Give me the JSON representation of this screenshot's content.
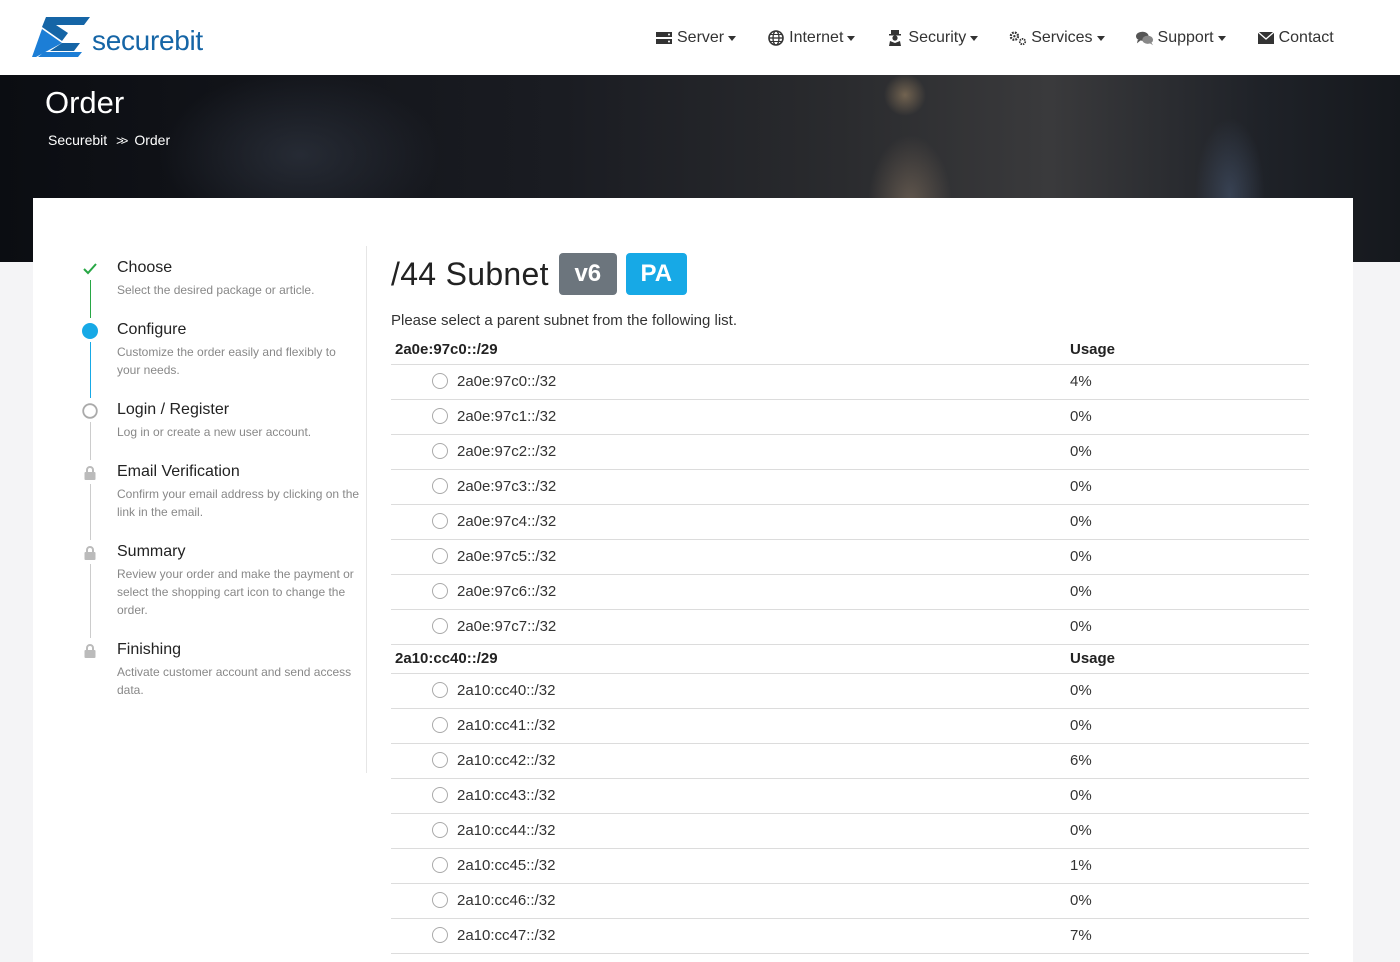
{
  "brand": {
    "name": "securebit",
    "color": "#1565a6"
  },
  "nav": [
    {
      "label": "Server",
      "icon": "server-icon",
      "dropdown": true
    },
    {
      "label": "Internet",
      "icon": "globe-icon",
      "dropdown": true
    },
    {
      "label": "Security",
      "icon": "user-secret-icon",
      "dropdown": true
    },
    {
      "label": "Services",
      "icon": "gears-icon",
      "dropdown": true
    },
    {
      "label": "Support",
      "icon": "comments-icon",
      "dropdown": true
    },
    {
      "label": "Contact",
      "icon": "envelope-icon",
      "dropdown": false
    }
  ],
  "hero": {
    "title": "Order",
    "breadcrumb": [
      "Securebit",
      "Order"
    ]
  },
  "steps": [
    {
      "title": "Choose",
      "desc": "Select the desired package or article.",
      "state": "done"
    },
    {
      "title": "Configure",
      "desc": "Customize the order easily and flexibly to your needs.",
      "state": "active"
    },
    {
      "title": "Login / Register",
      "desc": "Log in or create a new user account.",
      "state": "pending"
    },
    {
      "title": "Email Verification",
      "desc": "Confirm your email address by clicking on the link in the email.",
      "state": "locked"
    },
    {
      "title": "Summary",
      "desc": "Review your order and make the payment or select the shopping cart icon to change the order.",
      "state": "locked"
    },
    {
      "title": "Finishing",
      "desc": "Activate customer account and send access data.",
      "state": "locked"
    }
  ],
  "main": {
    "title": "/44 Subnet",
    "badges": [
      "v6",
      "PA"
    ],
    "intro": "Please select a parent subnet from the following list.",
    "usage_label": "Usage",
    "groups": [
      {
        "parent": "2a0e:97c0::/29",
        "rows": [
          {
            "subnet": "2a0e:97c0::/32",
            "usage": "4%"
          },
          {
            "subnet": "2a0e:97c1::/32",
            "usage": "0%"
          },
          {
            "subnet": "2a0e:97c2::/32",
            "usage": "0%"
          },
          {
            "subnet": "2a0e:97c3::/32",
            "usage": "0%"
          },
          {
            "subnet": "2a0e:97c4::/32",
            "usage": "0%"
          },
          {
            "subnet": "2a0e:97c5::/32",
            "usage": "0%"
          },
          {
            "subnet": "2a0e:97c6::/32",
            "usage": "0%"
          },
          {
            "subnet": "2a0e:97c7::/32",
            "usage": "0%"
          }
        ]
      },
      {
        "parent": "2a10:cc40::/29",
        "rows": [
          {
            "subnet": "2a10:cc40::/32",
            "usage": "0%"
          },
          {
            "subnet": "2a10:cc41::/32",
            "usage": "0%"
          },
          {
            "subnet": "2a10:cc42::/32",
            "usage": "6%"
          },
          {
            "subnet": "2a10:cc43::/32",
            "usage": "0%"
          },
          {
            "subnet": "2a10:cc44::/32",
            "usage": "0%"
          },
          {
            "subnet": "2a10:cc45::/32",
            "usage": "1%"
          },
          {
            "subnet": "2a10:cc46::/32",
            "usage": "0%"
          },
          {
            "subnet": "2a10:cc47::/32",
            "usage": "7%"
          }
        ]
      }
    ]
  },
  "colors": {
    "accent": "#17a9e6",
    "done": "#28a745",
    "badge_grey": "#6c757d"
  }
}
